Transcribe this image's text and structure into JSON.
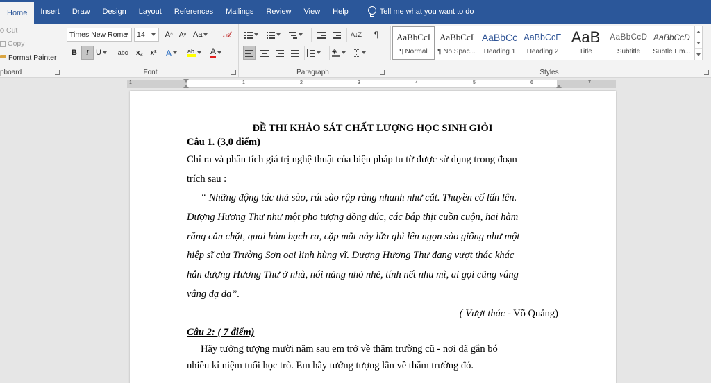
{
  "tabs": [
    "Home",
    "Insert",
    "Draw",
    "Design",
    "Layout",
    "References",
    "Mailings",
    "Review",
    "View",
    "Help"
  ],
  "active_tab": "Home",
  "tell_me": "Tell me what you want to do",
  "clipboard": {
    "cut": "Cut",
    "copy": "Copy",
    "format_painter": "Format Painter",
    "label": "pboard"
  },
  "font": {
    "name": "Times New Roma",
    "size": "14",
    "grow": "A",
    "shrink": "A",
    "case": "Aa",
    "bold": "B",
    "italic": "I",
    "underline": "U",
    "strike": "abc",
    "sub": "x₂",
    "sup": "x²",
    "effects": "A",
    "color": "A",
    "label": "Font"
  },
  "paragraph": {
    "label": "Paragraph",
    "sort": "A↓Z",
    "pilcrow": "¶"
  },
  "styles": {
    "label": "Styles",
    "items": [
      {
        "preview": "AaBbCcI",
        "name": "¶ Normal"
      },
      {
        "preview": "AaBbCcI",
        "name": "¶ No Spac..."
      },
      {
        "preview": "AaBbCc",
        "name": "Heading 1"
      },
      {
        "preview": "AaBbCcE",
        "name": "Heading 2"
      },
      {
        "preview": "AaB",
        "name": "Title"
      },
      {
        "preview": "AaBbCcD",
        "name": "Subtitle"
      },
      {
        "preview": "AaBbCcD",
        "name": "Subtle Em..."
      }
    ]
  },
  "ruler_numbers": [
    "1",
    "1",
    "2",
    "3",
    "4",
    "5",
    "6",
    "7"
  ],
  "doc": {
    "title": "ĐỀ THI KHẢO SÁT CHẤT LƯỢNG HỌC SINH GIỎI",
    "q1_label": "Câu 1",
    "q1_points": ". (3,0 điểm)",
    "q1_lines": [
      " Chỉ ra và phân tích giá trị nghệ thuật của biện pháp tu từ được sử dụng trong đoạn",
      "trích sau :"
    ],
    "quote_lines": [
      "“ Những động tác thả sào, rút sào rập ràng nhanh như cắt. Thuyền cố lấn lên.",
      "Dượng Hương Thư như một pho tượng đồng đúc, các bắp thịt cuồn cuộn, hai hàm",
      "răng cắn chặt, quai hàm bạch ra, cặp mắt nảy lửa ghì lên ngọn sào giống như một",
      "hiệp sĩ của Trường Sơn oai linh hùng vĩ. Dượng Hương Thư đang vượt thác khác",
      "hẳn dượng Hương Thư ở nhà, nói năng nhỏ nhẻ, tính nết nhu mì, ai gọi cũng vâng",
      "vâng dạ dạ”."
    ],
    "source_work": "( Vượt thác",
    "source_author": " - Võ Quảng)",
    "q2_label": "Câu 2: ( 7 điểm)",
    "q2_lines": [
      "Hãy tưởng tượng  mười năm sau  em trở về thăm trường cũ -  nơi đã gắn bó",
      "nhiều kỉ niệm tuổi học trò.  Em hãy tưởng tượng lần về thăm trường đó."
    ]
  }
}
